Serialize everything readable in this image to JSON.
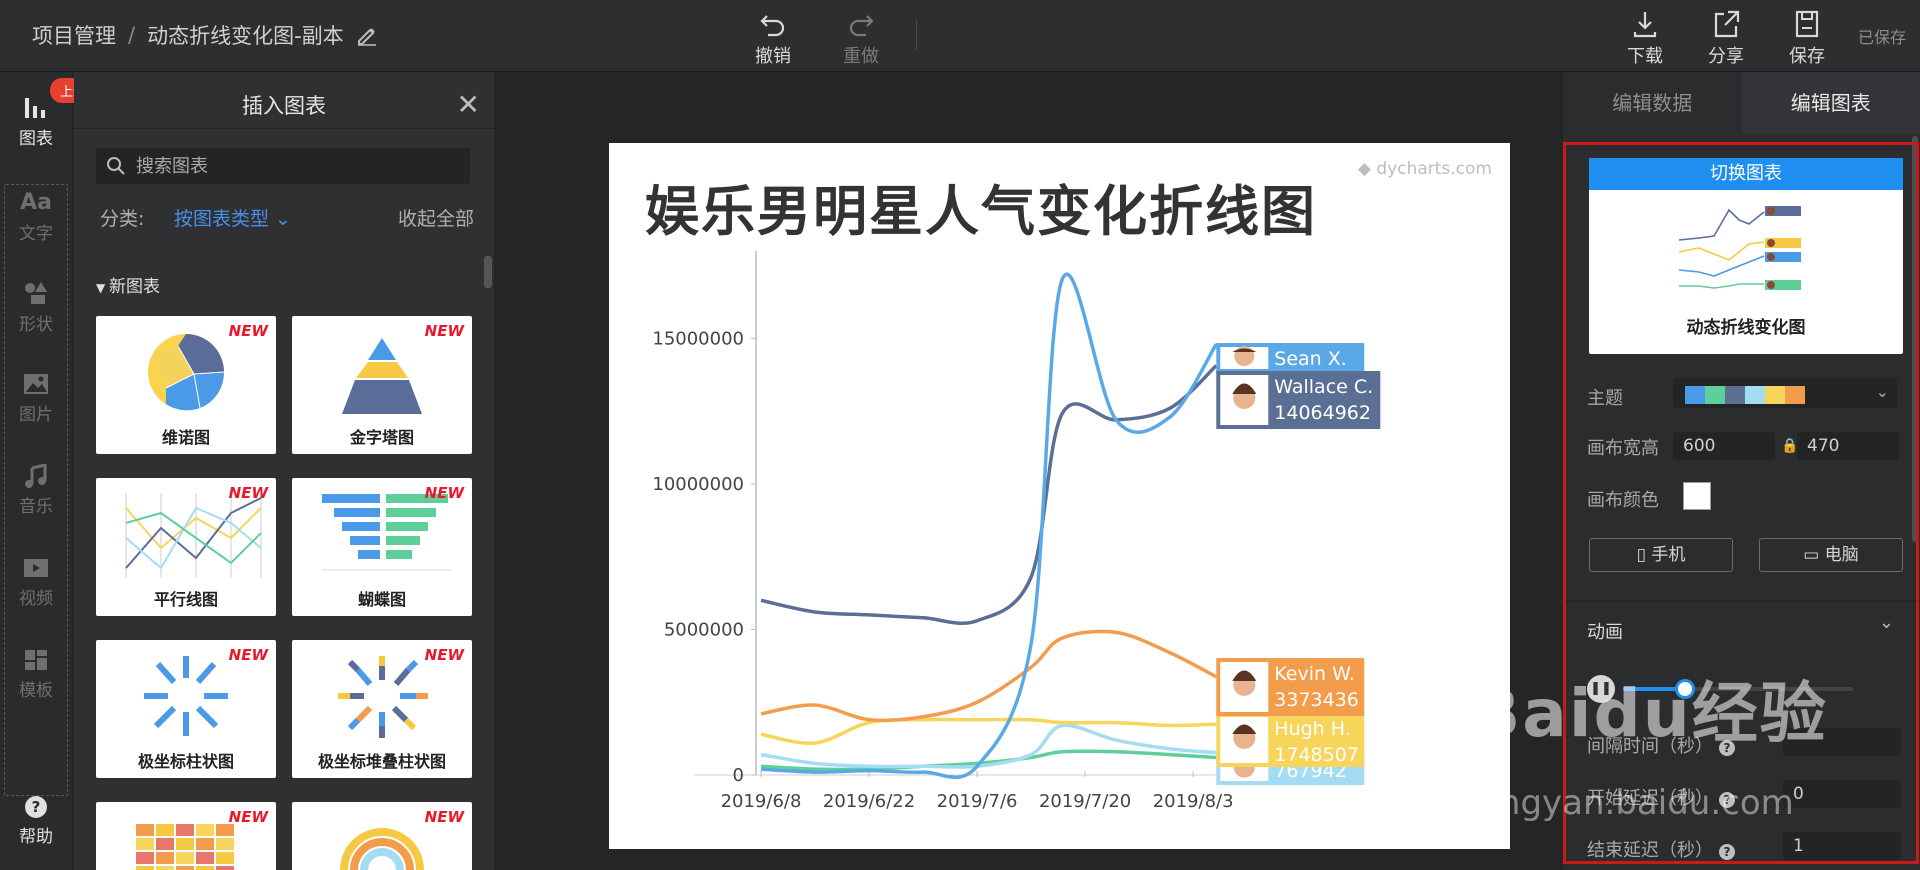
{
  "topbar": {
    "breadcrumb_root": "项目管理",
    "breadcrumb_sep": "/",
    "project_name": "动态折线变化图-副本",
    "undo": "撤销",
    "redo": "重做",
    "download": "下载",
    "share": "分享",
    "save": "保存",
    "saved_status": "已保存"
  },
  "rail": {
    "badge": "上新",
    "items": [
      {
        "label": "图表",
        "icon": "bar-chart-icon"
      },
      {
        "label": "文字",
        "icon": "text-icon"
      },
      {
        "label": "形状",
        "icon": "shapes-icon"
      },
      {
        "label": "图片",
        "icon": "image-icon"
      },
      {
        "label": "音乐",
        "icon": "music-icon"
      },
      {
        "label": "视频",
        "icon": "video-icon"
      },
      {
        "label": "模板",
        "icon": "template-icon"
      }
    ],
    "help": "帮助"
  },
  "panel": {
    "title": "插入图表",
    "search_placeholder": "搜索图表",
    "category_label": "分类:",
    "category_value": "按图表类型",
    "collapse_all": "收起全部",
    "section": "新图表",
    "new_tag": "NEW",
    "cards": [
      "维诺图",
      "金字塔图",
      "平行线图",
      "蝴蝶图",
      "极坐标柱状图",
      "极坐标堆叠柱状图",
      "",
      ""
    ]
  },
  "canvas": {
    "watermark": "dycharts.com",
    "title": "娱乐男明星人气变化折线图"
  },
  "chart_data": {
    "type": "line",
    "title": "娱乐男明星人气变化折线图",
    "x_ticks": [
      "2019/6/8",
      "2019/6/22",
      "2019/7/6",
      "2019/7/20",
      "2019/8/3"
    ],
    "y_ticks": [
      0,
      5000000,
      10000000,
      15000000
    ],
    "y_tick_labels": [
      "0",
      "5000000",
      "10000000",
      "15000000"
    ],
    "ylim": [
      0,
      18000000
    ],
    "x": [
      "2019/6/8",
      "2019/6/15",
      "2019/6/22",
      "2019/6/29",
      "2019/7/6",
      "2019/7/13",
      "2019/7/17",
      "2019/7/24",
      "2019/7/31",
      "2019/8/6"
    ],
    "series": [
      {
        "name": "Sean X.",
        "color": "#5aa9e6",
        "values": [
          200000,
          100000,
          150000,
          100000,
          300000,
          4500000,
          17000000,
          12200000,
          12300000,
          14800000
        ]
      },
      {
        "name": "Wallace C.",
        "value_label": "14064962",
        "color": "#5b6f95",
        "values": [
          6000000,
          5600000,
          5500000,
          5400000,
          5300000,
          6800000,
          12400000,
          12200000,
          12600000,
          14064962
        ]
      },
      {
        "name": "Kevin W.",
        "value_label": "3373436",
        "color": "#f39c4b",
        "values": [
          2100000,
          2400000,
          1900000,
          2000000,
          2500000,
          3700000,
          4700000,
          4900000,
          4200000,
          3373436
        ]
      },
      {
        "name": "Hugh H.",
        "value_label": "1748507",
        "color": "#f7d55a",
        "values": [
          1400000,
          1100000,
          1800000,
          1900000,
          1900000,
          1900000,
          1800000,
          1800000,
          1700000,
          1748507
        ]
      },
      {
        "name": "",
        "value_label": "767942",
        "color": "#a3dcf3",
        "values": [
          700000,
          400000,
          300000,
          300000,
          300000,
          700000,
          1700000,
          1200000,
          900000,
          767942
        ]
      },
      {
        "name": "",
        "color": "#5fcf9a",
        "values": [
          300000,
          200000,
          200000,
          300000,
          400000,
          600000,
          800000,
          800000,
          700000,
          600000
        ]
      }
    ]
  },
  "right": {
    "tab_data": "编辑数据",
    "tab_chart": "编辑图表",
    "switch_chart": "切换图表",
    "chart_name": "动态折线变化图",
    "theme_label": "主题",
    "theme_colors": [
      "#4a9ae8",
      "#5fcf9a",
      "#5b6f95",
      "#a3dcf3",
      "#f7d55a",
      "#f39c4b"
    ],
    "canvas_size_label": "画布宽高",
    "width": "600",
    "height": "470",
    "canvas_color_label": "画布颜色",
    "mobile": "手机",
    "desktop": "电脑",
    "animation": "动画",
    "interval_label": "间隔时间（秒）",
    "start_delay_label": "开始延迟（秒）",
    "start_delay_value": "0",
    "end_delay_label": "结束延迟（秒）",
    "end_delay_value": "1",
    "progress": 0.25
  },
  "watermark_overlay": {
    "text": "Baidu经验",
    "sub": "jingyan.baidu.com"
  }
}
